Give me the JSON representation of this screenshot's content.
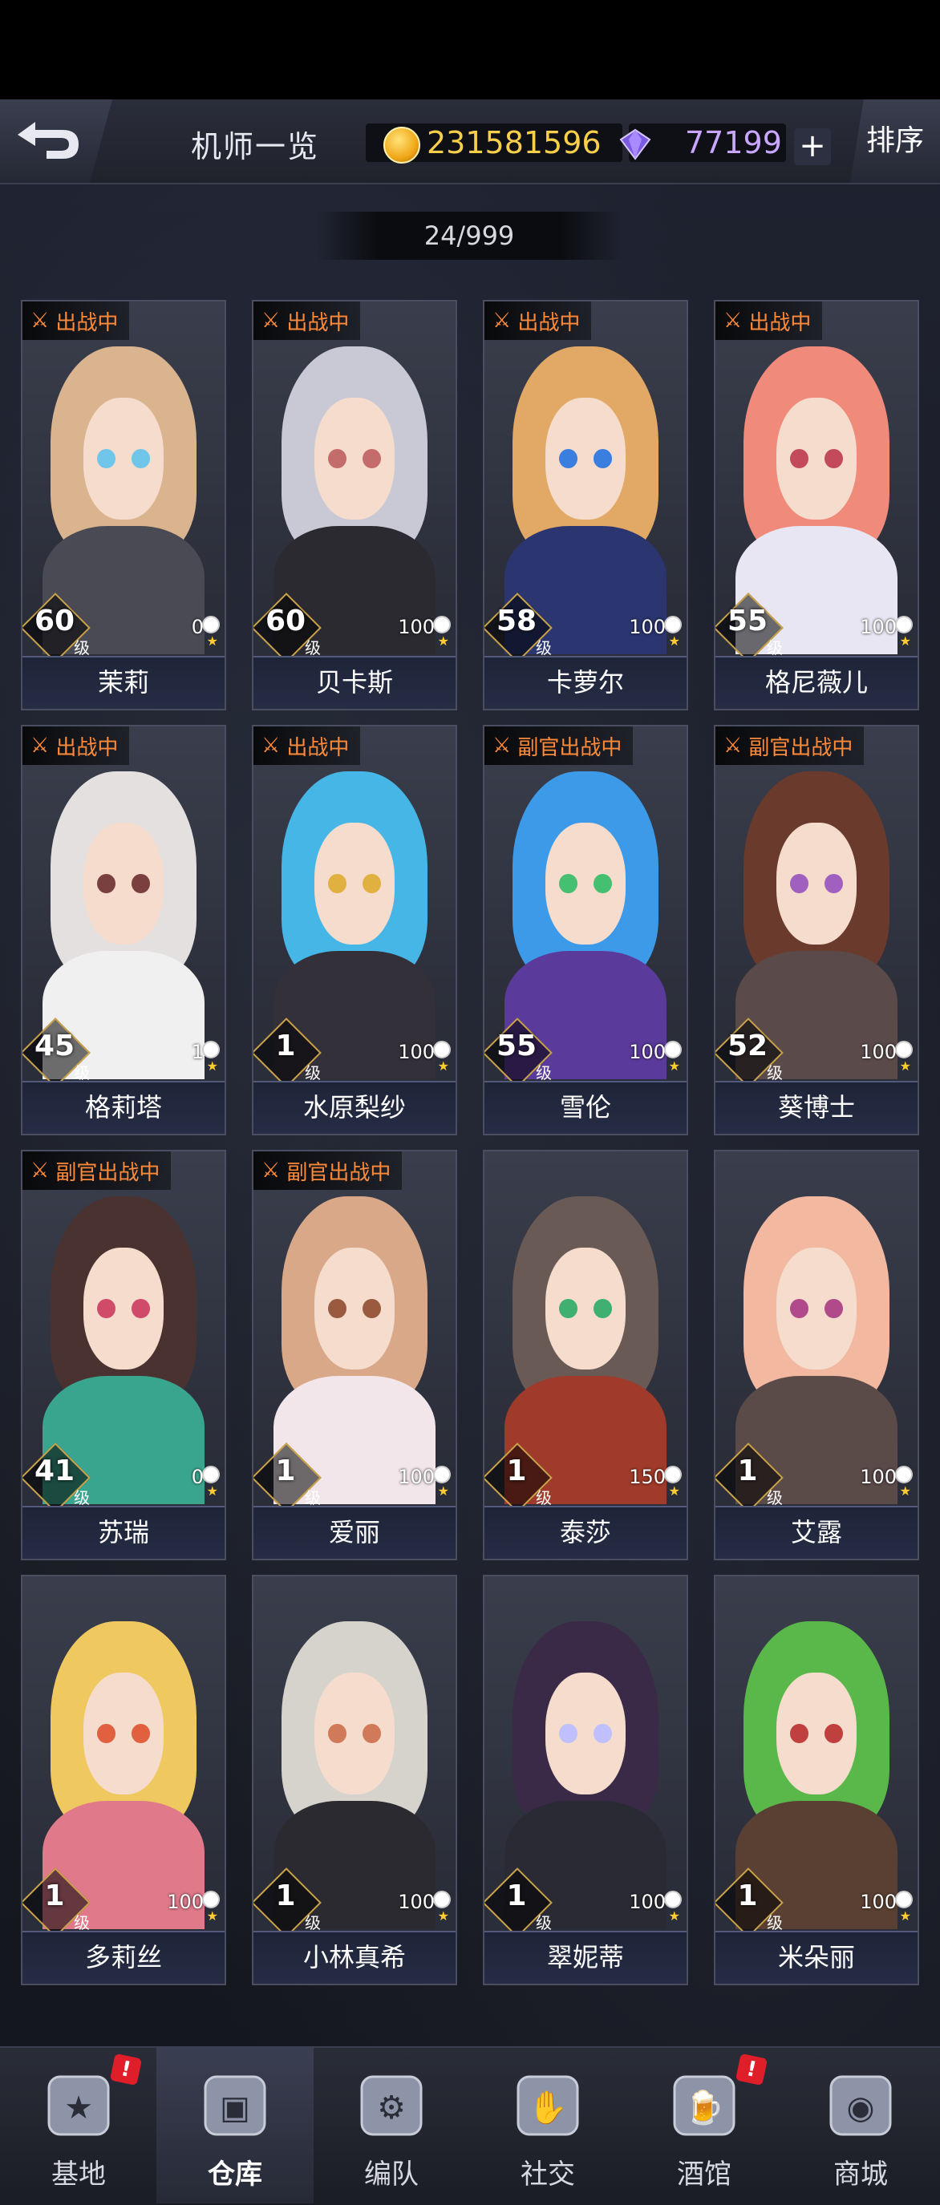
{
  "header": {
    "title": "机师一览",
    "coins": "231581596",
    "gems": "77199",
    "plus": "+",
    "sort": "排序"
  },
  "counter": "24/999",
  "pilots": [
    {
      "name": "茉莉",
      "level": "60",
      "unit": "级",
      "trust": "0",
      "status": "出战中",
      "hair": "#d9b48f",
      "eye": "#6fc6e8",
      "outfit": "#4a4a55"
    },
    {
      "name": "贝卡斯",
      "level": "60",
      "unit": "级",
      "trust": "100",
      "status": "出战中",
      "hair": "#c9c9d6",
      "eye": "#c46c6c",
      "outfit": "#2a2a30"
    },
    {
      "name": "卡萝尔",
      "level": "58",
      "unit": "级",
      "trust": "100",
      "status": "出战中",
      "hair": "#e2a865",
      "eye": "#3a7fe0",
      "outfit": "#2b3570"
    },
    {
      "name": "格尼薇儿",
      "level": "55",
      "unit": "级",
      "trust": "100",
      "status": "出战中",
      "hair": "#f08a7a",
      "eye": "#c24a5a",
      "outfit": "#e8e6f2"
    },
    {
      "name": "格莉塔",
      "level": "45",
      "unit": "级",
      "trust": "1",
      "status": "出战中",
      "hair": "#e4e0e0",
      "eye": "#7a4040",
      "outfit": "#f0f0f0"
    },
    {
      "name": "水原梨纱",
      "level": "1",
      "unit": "级",
      "trust": "100",
      "status": "出战中",
      "hair": "#46b6e6",
      "eye": "#e0b040",
      "outfit": "#33303a"
    },
    {
      "name": "雪伦",
      "level": "55",
      "unit": "级",
      "trust": "100",
      "status": "副官出战中",
      "hair": "#3d9ae8",
      "eye": "#44c070",
      "outfit": "#5a3a9a"
    },
    {
      "name": "葵博士",
      "level": "52",
      "unit": "级",
      "trust": "100",
      "status": "副官出战中",
      "hair": "#6a3a2c",
      "eye": "#a060c0",
      "outfit": "#5a4a4a"
    },
    {
      "name": "苏瑞",
      "level": "41",
      "unit": "级",
      "trust": "0",
      "status": "副官出战中",
      "hair": "#4a3230",
      "eye": "#d04a6a",
      "outfit": "#3aa58f"
    },
    {
      "name": "爱丽",
      "level": "1",
      "unit": "级",
      "trust": "100",
      "status": "副官出战中",
      "hair": "#d8a888",
      "eye": "#9a5a40",
      "outfit": "#f2e6ea"
    },
    {
      "name": "泰莎",
      "level": "1",
      "unit": "级",
      "trust": "150",
      "status": "",
      "hair": "#6a5a55",
      "eye": "#40b070",
      "outfit": "#a03a2a"
    },
    {
      "name": "艾露",
      "level": "1",
      "unit": "级",
      "trust": "100",
      "status": "",
      "hair": "#f2b8a0",
      "eye": "#b04a8a",
      "outfit": "#5a4a48"
    },
    {
      "name": "多莉丝",
      "level": "1",
      "unit": "级",
      "trust": "100",
      "status": "",
      "hair": "#f0c860",
      "eye": "#e06040",
      "outfit": "#e07a8a"
    },
    {
      "name": "小林真希",
      "level": "1",
      "unit": "级",
      "trust": "100",
      "status": "",
      "hair": "#d6d2cc",
      "eye": "#d07a5a",
      "outfit": "#2a2a30"
    },
    {
      "name": "翠妮蒂",
      "level": "1",
      "unit": "级",
      "trust": "100",
      "status": "",
      "hair": "#3a2a48",
      "eye": "#c0c0ff",
      "outfit": "#2a2a34"
    },
    {
      "name": "米朵丽",
      "level": "1",
      "unit": "级",
      "trust": "100",
      "status": "",
      "hair": "#5ab84a",
      "eye": "#c04040",
      "outfit": "#5a4032"
    }
  ],
  "nav": [
    {
      "label": "基地",
      "badge": "!",
      "active": false
    },
    {
      "label": "仓库",
      "badge": "",
      "active": true
    },
    {
      "label": "编队",
      "badge": "",
      "active": false
    },
    {
      "label": "社交",
      "badge": "",
      "active": false
    },
    {
      "label": "酒馆",
      "badge": "!",
      "active": false
    },
    {
      "label": "商城",
      "badge": "",
      "active": false
    }
  ]
}
